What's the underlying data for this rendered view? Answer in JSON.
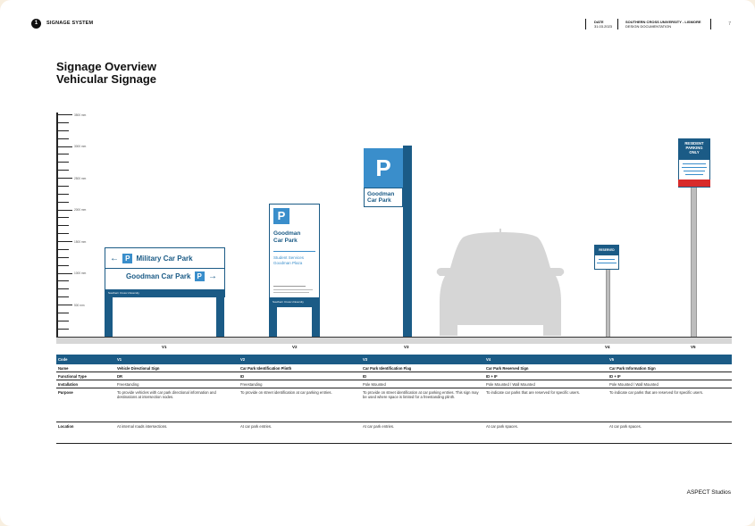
{
  "header": {
    "section_number": "1",
    "section_title": "SIGNAGE SYSTEM",
    "date_label": "DATE",
    "date_value": "31.03.2023",
    "client": "SOUTHERN CROSS UNIVERSITY - LISMORE",
    "doc_type": "DESIGN DOCUMENTATION",
    "page_number": "7"
  },
  "title_line1": "Signage Overview",
  "title_line2": "Vehicular Signage",
  "scale_labels": [
    "3500 mm",
    "3000 mm",
    "2500 mm",
    "2000 mm",
    "1500 mm",
    "1000 mm",
    "500 mm"
  ],
  "signs": {
    "v1": {
      "row1": "Military Car Park",
      "row2": "Goodman Car Park",
      "p": "P",
      "arrow_left": "←",
      "arrow_right": "→",
      "band": "Southern Cross University"
    },
    "v2": {
      "p": "P",
      "name_line1": "Goodman",
      "name_line2": "Car Park",
      "sub_line1": "Student Services",
      "sub_line2": "Goodman Plaza",
      "band": "Southern Cross University"
    },
    "v3": {
      "p": "P",
      "name_line1": "Goodman",
      "name_line2": "Car Park"
    },
    "v4": {
      "head": "RESERVED"
    },
    "v5": {
      "head_line1": "RESIDENT",
      "head_line2": "PARKING",
      "head_line3": "ONLY"
    }
  },
  "codes": [
    "V1",
    "V2",
    "V3",
    "V4",
    "V5"
  ],
  "table": {
    "header": [
      "Code",
      "V1",
      "V2",
      "V3",
      "V4",
      "V5"
    ],
    "rows": [
      [
        "Name",
        "Vehicle Directional Sign",
        "Car Park Identification Plinth",
        "Car Park Identification Flag",
        "Car Park Reserved Sign",
        "Car Park Information Sign"
      ],
      [
        "Functional Type",
        "DR",
        "ID",
        "ID",
        "ID + IF",
        "ID + IF"
      ],
      [
        "Installation",
        "Freestanding",
        "Freestanding",
        "Pole Mounted",
        "Pole Mounted / Wall Mounted",
        "Pole Mounted / Wall Mounted"
      ],
      [
        "Purpose",
        "To provide vehicles with car park directional information and destinations at intersection nodes.",
        "To provide on street identification at car parking entries.",
        "To provide on street identification at car parking entries. This sign may be used where space is limited for a freestanding plinth.",
        "To indicate car parks that are reserved for specific users.",
        "To indicate car parks that are reserved for specific users."
      ],
      [
        "Location",
        "At internal roads intersections.",
        "At car park entries.",
        "At car park entries.",
        "At car park spaces.",
        "At car park spaces."
      ]
    ]
  },
  "brand": "ASPECT Studios"
}
